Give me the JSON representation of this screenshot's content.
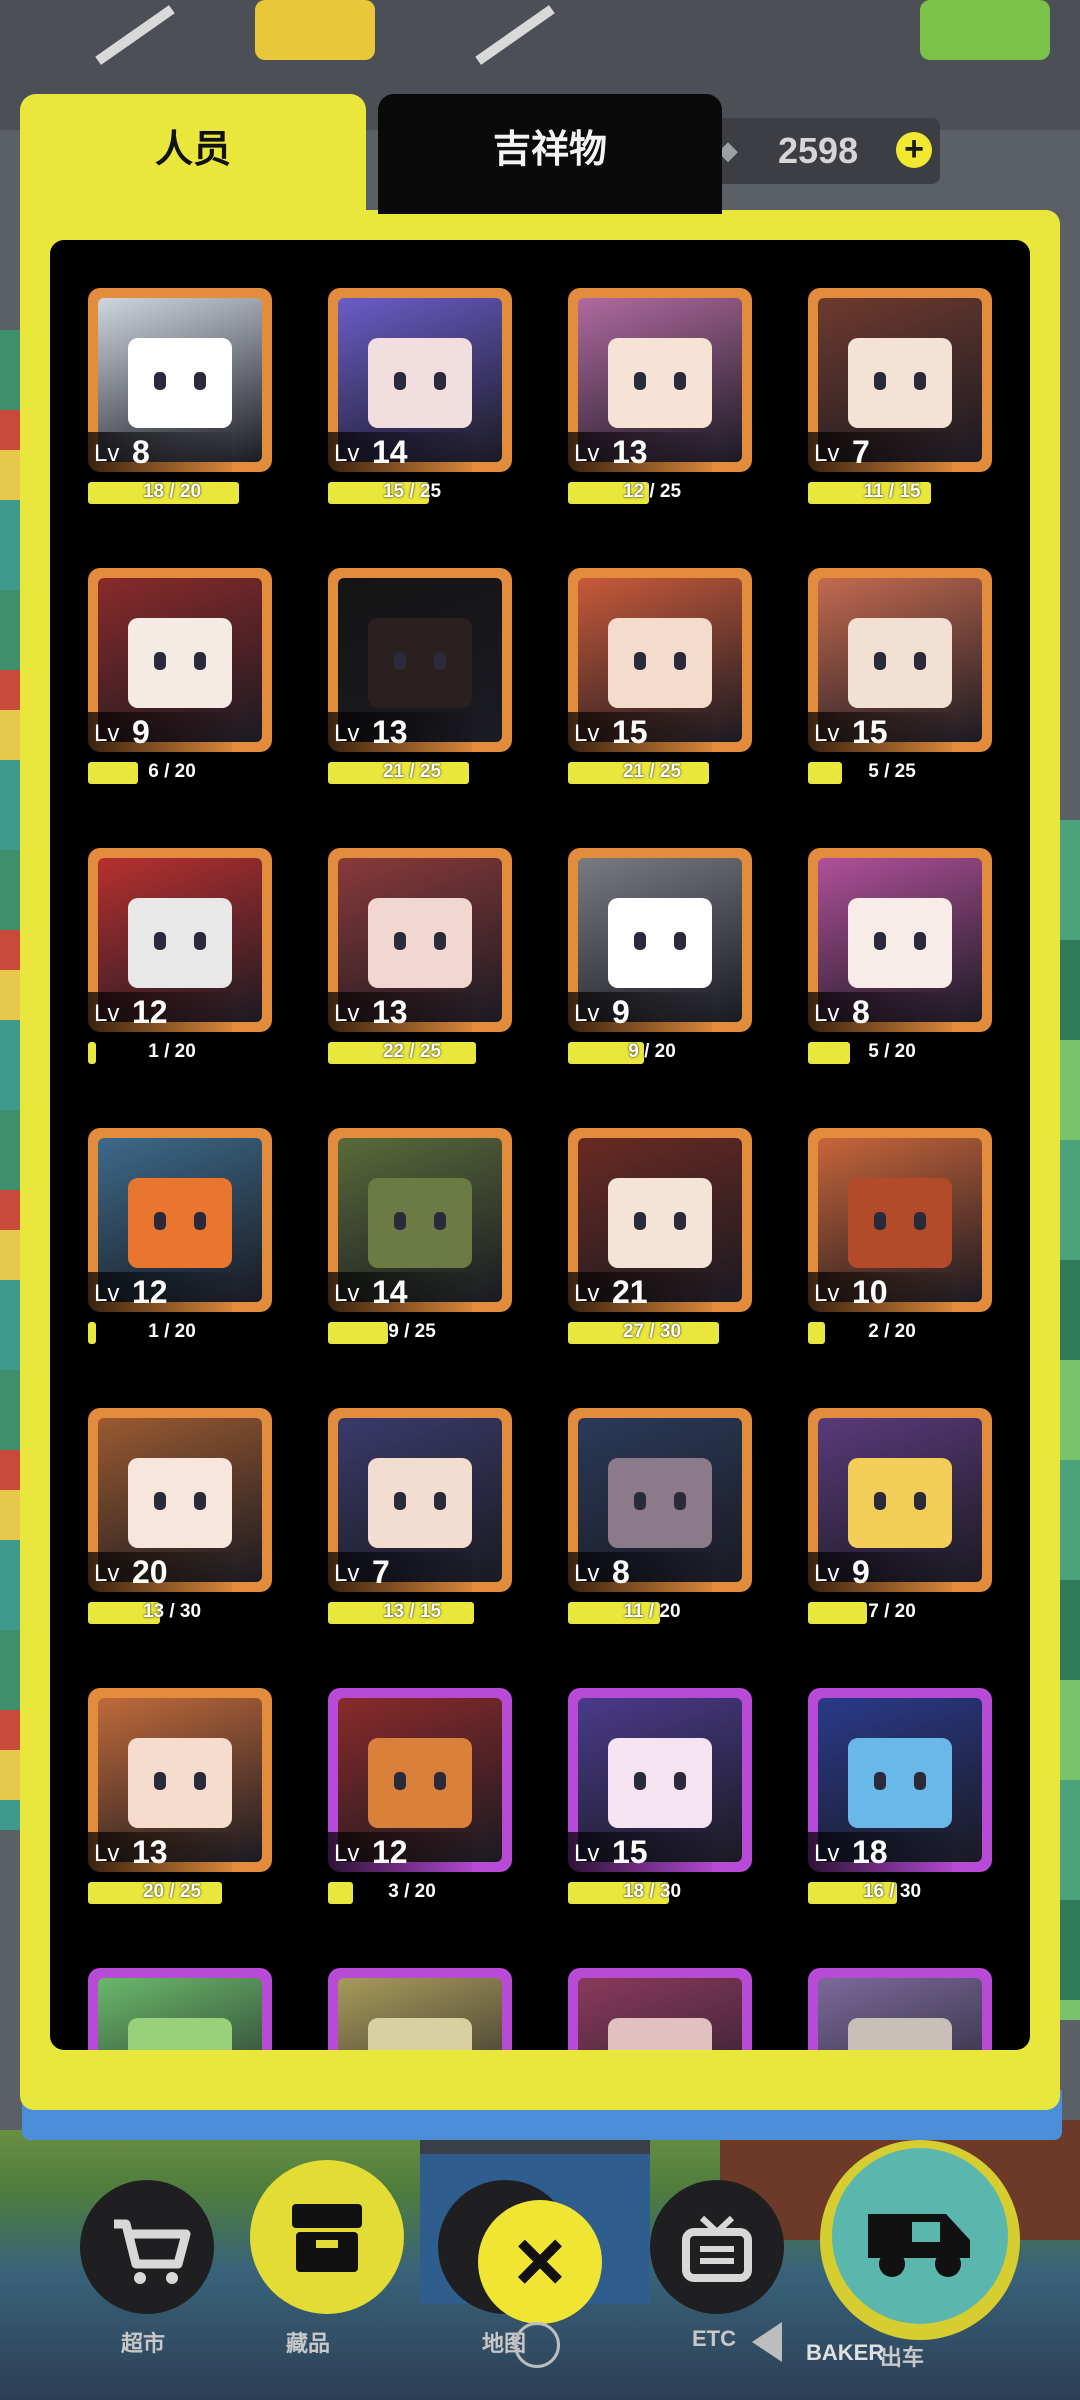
{
  "tabs": [
    {
      "label": "人员",
      "active": true
    },
    {
      "label": "吉祥物",
      "active": false
    }
  ],
  "currency": {
    "icon": "gem-icon",
    "value": "2598",
    "add_icon": "+"
  },
  "cards": [
    {
      "lv_prefix": "Lv",
      "level": "8",
      "progress": "18 / 20",
      "fraction": 0.9,
      "frame": "orange",
      "icon": "panda-character-icon",
      "tint": "#cfd6e0",
      "face": "#ffffff"
    },
    {
      "lv_prefix": "Lv",
      "level": "14",
      "progress": "15 / 25",
      "fraction": 0.6,
      "frame": "orange",
      "icon": "cyber-cat-character-icon",
      "tint": "#6b5cc8",
      "face": "#f2dede"
    },
    {
      "lv_prefix": "Lv",
      "level": "13",
      "progress": "12 / 25",
      "fraction": 0.48,
      "frame": "orange",
      "icon": "donut-character-icon",
      "tint": "#b06aa0",
      "face": "#f7e2d6"
    },
    {
      "lv_prefix": "Lv",
      "level": "7",
      "progress": "11 / 15",
      "fraction": 0.73,
      "frame": "orange",
      "icon": "christmas-tree-character-icon",
      "tint": "#6e3a2e",
      "face": "#f4e2d6"
    },
    {
      "lv_prefix": "Lv",
      "level": "9",
      "progress": "6 / 20",
      "fraction": 0.3,
      "frame": "orange",
      "icon": "lion-dance-character-icon",
      "tint": "#8a2a2a",
      "face": "#f4ece4"
    },
    {
      "lv_prefix": "Lv",
      "level": "13",
      "progress": "21 / 25",
      "fraction": 0.84,
      "frame": "orange",
      "icon": "shadow-monster-character-icon",
      "tint": "#151515",
      "face": "#2a2020"
    },
    {
      "lv_prefix": "Lv",
      "level": "15",
      "progress": "21 / 25",
      "fraction": 0.84,
      "frame": "orange",
      "icon": "crayfish-chef-character-icon",
      "tint": "#c85a3a",
      "face": "#f3dccc"
    },
    {
      "lv_prefix": "Lv",
      "level": "15",
      "progress": "5 / 25",
      "fraction": 0.2,
      "frame": "orange",
      "icon": "noodle-bowl-character-icon",
      "tint": "#c46a50",
      "face": "#f2e0d2"
    },
    {
      "lv_prefix": "Lv",
      "level": "12",
      "progress": "1 / 20",
      "fraction": 0.05,
      "frame": "orange",
      "icon": "dragon-character-icon",
      "tint": "#b83030",
      "face": "#e8e8e8"
    },
    {
      "lv_prefix": "Lv",
      "level": "13",
      "progress": "22 / 25",
      "fraction": 0.88,
      "frame": "orange",
      "icon": "opera-character-icon",
      "tint": "#8a3a3a",
      "face": "#f2d6d0"
    },
    {
      "lv_prefix": "Lv",
      "level": "9",
      "progress": "9 / 20",
      "fraction": 0.45,
      "frame": "orange",
      "icon": "professor-character-icon",
      "tint": "#7a7a82",
      "face": "#ffffff"
    },
    {
      "lv_prefix": "Lv",
      "level": "8",
      "progress": "5 / 20",
      "fraction": 0.25,
      "frame": "orange",
      "icon": "pink-hair-character-icon",
      "tint": "#b0509a",
      "face": "#f7ece8"
    },
    {
      "lv_prefix": "Lv",
      "level": "12",
      "progress": "1 / 20",
      "fraction": 0.05,
      "frame": "orange",
      "icon": "clownfish-character-icon",
      "tint": "#3d6a8a",
      "face": "#e9762e"
    },
    {
      "lv_prefix": "Lv",
      "level": "14",
      "progress": "9 / 25",
      "fraction": 0.36,
      "frame": "orange",
      "icon": "robot-soldier-character-icon",
      "tint": "#5a6a3a",
      "face": "#6c7a44"
    },
    {
      "lv_prefix": "Lv",
      "level": "21",
      "progress": "27 / 30",
      "fraction": 0.9,
      "frame": "orange",
      "icon": "peony-lady-character-icon",
      "tint": "#6a2a22",
      "face": "#f4e4d8"
    },
    {
      "lv_prefix": "Lv",
      "level": "10",
      "progress": "2 / 20",
      "fraction": 0.1,
      "frame": "orange",
      "icon": "fox-character-icon",
      "tint": "#c8653a",
      "face": "#b34a2a"
    },
    {
      "lv_prefix": "Lv",
      "level": "20",
      "progress": "13 / 30",
      "fraction": 0.43,
      "frame": "orange",
      "icon": "court-lady-character-icon",
      "tint": "#9a5a30",
      "face": "#f6e6dc"
    },
    {
      "lv_prefix": "Lv",
      "level": "7",
      "progress": "13 / 15",
      "fraction": 0.87,
      "frame": "orange",
      "icon": "sailor-character-icon",
      "tint": "#3a3a6a",
      "face": "#f2ddd0"
    },
    {
      "lv_prefix": "Lv",
      "level": "8",
      "progress": "11 / 20",
      "fraction": 0.55,
      "frame": "orange",
      "icon": "mech-pilot-character-icon",
      "tint": "#2a3a5a",
      "face": "#8a7a8a"
    },
    {
      "lv_prefix": "Lv",
      "level": "9",
      "progress": "7 / 20",
      "fraction": 0.35,
      "frame": "orange",
      "icon": "magic-bunny-character-icon",
      "tint": "#5a3a7a",
      "face": "#f3cf5a"
    },
    {
      "lv_prefix": "Lv",
      "level": "13",
      "progress": "20 / 25",
      "fraction": 0.8,
      "frame": "orange",
      "icon": "salad-girl-character-icon",
      "tint": "#c06a3a",
      "face": "#f6dccc"
    },
    {
      "lv_prefix": "Lv",
      "level": "12",
      "progress": "3 / 20",
      "fraction": 0.15,
      "frame": "purple",
      "icon": "gingerbread-character-icon",
      "tint": "#8a2a2a",
      "face": "#d9803a"
    },
    {
      "lv_prefix": "Lv",
      "level": "15",
      "progress": "18 / 30",
      "fraction": 0.6,
      "frame": "purple",
      "icon": "propeller-hat-character-icon",
      "tint": "#4a3a8a",
      "face": "#f4e4f0"
    },
    {
      "lv_prefix": "Lv",
      "level": "18",
      "progress": "16 / 30",
      "fraction": 0.53,
      "frame": "purple",
      "icon": "toaster-character-icon",
      "tint": "#2a3a8a",
      "face": "#6ab8e8"
    },
    {
      "lv_prefix": "",
      "level": "",
      "progress": "",
      "fraction": 0,
      "frame": "purple",
      "icon": "leaf-character-icon",
      "tint": "#6ab86a",
      "face": "#9ad07a"
    },
    {
      "lv_prefix": "",
      "level": "",
      "progress": "",
      "fraction": 0,
      "frame": "purple",
      "icon": "box-character-icon",
      "tint": "#a89a5a",
      "face": "#d8d0a0"
    },
    {
      "lv_prefix": "",
      "level": "",
      "progress": "",
      "fraction": 0,
      "frame": "purple",
      "icon": "santa-hat-character-icon",
      "tint": "#8a3a5a",
      "face": "#e0c0c0"
    },
    {
      "lv_prefix": "",
      "level": "",
      "progress": "",
      "fraction": 0,
      "frame": "purple",
      "icon": "viking-character-icon",
      "tint": "#7a6a9a",
      "face": "#c8c0b8"
    }
  ],
  "nav": [
    {
      "label": "超市",
      "icon": "shopping-cart-icon"
    },
    {
      "label": "藏品",
      "icon": "collection-box-icon"
    },
    {
      "label": "地图",
      "icon": "map-icon"
    },
    {
      "label": "ETC",
      "icon": "tv-icon"
    },
    {
      "label": "出车",
      "icon": "truck-icon"
    }
  ],
  "close_icon": "×",
  "store_sign": "BAKER"
}
